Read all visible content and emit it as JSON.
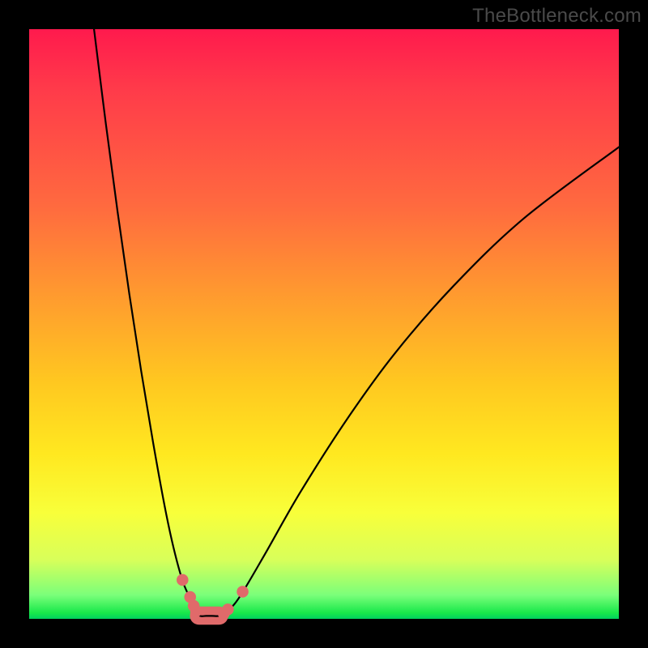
{
  "watermark": "TheBottleneck.com",
  "chart_data": {
    "type": "line",
    "title": "",
    "xlabel": "",
    "ylabel": "",
    "xlim": [
      0,
      100
    ],
    "ylim": [
      0,
      100
    ],
    "series": [
      {
        "name": "curve",
        "x": [
          11,
          13,
          15,
          17,
          19,
          21,
          23,
          24.5,
          26,
          27.2,
          28,
          29,
          30,
          31,
          32.5,
          34,
          36,
          40,
          46,
          54,
          62,
          72,
          84,
          100
        ],
        "y": [
          100,
          84,
          69,
          55,
          42,
          30,
          19,
          12,
          6.5,
          3.6,
          1.3,
          0.5,
          0.5,
          0.5,
          0.55,
          1.6,
          4.2,
          11,
          21.5,
          34,
          45,
          56.5,
          68,
          80
        ]
      }
    ],
    "markers": [
      {
        "name": "dot",
        "x": 26.0,
        "y": 6.6,
        "r": 1.0
      },
      {
        "name": "dot",
        "x": 27.3,
        "y": 3.7,
        "r": 1.0
      },
      {
        "name": "dot",
        "x": 27.9,
        "y": 2.2,
        "r": 1.0
      },
      {
        "name": "dot",
        "x": 28.3,
        "y": 1.3,
        "r": 1.0
      },
      {
        "name": "dot",
        "x": 33.0,
        "y": 0.9,
        "r": 1.0
      },
      {
        "name": "dot",
        "x": 33.7,
        "y": 1.6,
        "r": 1.0
      },
      {
        "name": "dot",
        "x": 36.2,
        "y": 4.6,
        "r": 1.0
      },
      {
        "name": "pill",
        "x1": 28.8,
        "y1": 0.55,
        "x2": 32.2,
        "y2": 0.55,
        "r": 1.55
      }
    ],
    "colors": {
      "curve": "#000000",
      "markers": "#e06a6a",
      "marker_stroke": "#d05858"
    }
  }
}
